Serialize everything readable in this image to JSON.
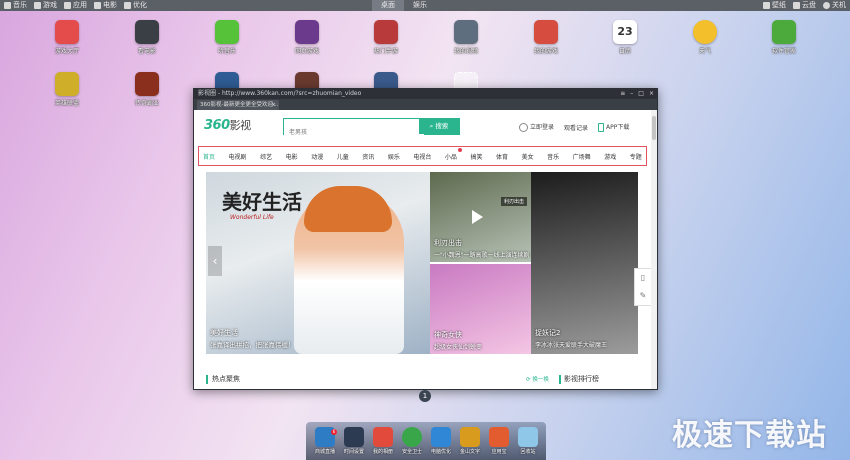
{
  "topbar": {
    "left": [
      {
        "label": "音乐",
        "color": "#d9d9d9"
      },
      {
        "label": "游戏",
        "color": "#d9d9d9"
      },
      {
        "label": "应用",
        "color": "#d9d9d9"
      },
      {
        "label": "电影",
        "color": "#d9d9d9"
      },
      {
        "label": "优化",
        "color": "#d9d9d9"
      }
    ],
    "center": [
      {
        "label": "桌面",
        "active": true
      },
      {
        "label": "娱乐",
        "active": false
      }
    ],
    "right": [
      {
        "label": "壁纸",
        "color": "#d9d9d9"
      },
      {
        "label": "云盘",
        "color": "#d9d9d9"
      },
      {
        "label": "关机",
        "color": "#d9d9d9"
      }
    ]
  },
  "desktop_icons": [
    {
      "label": "游戏大厅",
      "color": "#e44b4b",
      "icon": "joystick-icon"
    },
    {
      "label": "看电影",
      "color": "#3a3f46",
      "icon": "clapperboard-icon"
    },
    {
      "label": "听音乐",
      "color": "#56c23a",
      "icon": "music-note-icon"
    },
    {
      "label": "网页游戏",
      "color": "#6b3a8c",
      "icon": "game-icon"
    },
    {
      "label": "热门手游",
      "color": "#b83a3a",
      "icon": "game-icon"
    },
    {
      "label": "我的视频",
      "color": "#5e6e7e",
      "icon": "video-icon"
    },
    {
      "label": "我的游戏",
      "color": "#d64c3f",
      "icon": "game-icon"
    },
    {
      "label": "日历",
      "color": "#ffffff",
      "icon": "calendar-icon",
      "badge": "23"
    },
    {
      "label": "天气",
      "color": "#f3c02b",
      "icon": "weather-icon"
    },
    {
      "label": "软件管家",
      "color": "#4caa3c",
      "icon": "app-store-icon"
    },
    {
      "label": "英雄联盟",
      "color": "#cfae2a",
      "icon": "star-icon"
    },
    {
      "label": "传奇霸业",
      "color": "#8a2e1e",
      "icon": "game-icon"
    },
    {
      "label": "",
      "color": "#2f5c94",
      "icon": "game-icon"
    },
    {
      "label": "",
      "color": "#6a3a2f",
      "icon": "game-icon"
    },
    {
      "label": "",
      "color": "#3b5a8c",
      "icon": "game-icon"
    },
    {
      "label": "",
      "color": "rgba(255,255,255,0.5)",
      "icon": "add-icon"
    }
  ],
  "browser": {
    "title": "影视圈 - http://www.360kan.com/?src=zhuomian_video",
    "tab": "360影视-最新更全更全受欢迎...",
    "site": {
      "logo_num": "360",
      "logo_text": "影视",
      "search_placeholder": "老男孩",
      "search_button": "搜索",
      "login": "立即登录",
      "history": "观看记录",
      "app": "APP下载",
      "nav": [
        "首页",
        "电视剧",
        "综艺",
        "电影",
        "动漫",
        "儿童",
        "资讯",
        "娱乐",
        "电视台",
        "小品",
        "搞笑",
        "体育",
        "美女",
        "音乐",
        "广场舞",
        "游戏",
        "专题"
      ],
      "hero": {
        "calligraphy": "美好生活",
        "subtitle": "Wonderful Life",
        "title": "美好生活",
        "desc": "张嘉译出拼招，把张嘉伟缓！"
      },
      "tiles": [
        {
          "title": "利刃出击",
          "desc": "一\"小魏恩\"一路高歌一线上演连续剧",
          "badge": "利刃出击",
          "colors": [
            "#5d6a4e",
            "#b7c2b6"
          ]
        },
        {
          "title": "捉妖记2",
          "desc": "李冰冰张天爱联手大破魔王",
          "colors": [
            "#1c1c1c",
            "#9c9c9c"
          ]
        },
        {
          "title": "神奇女侠",
          "desc": "超级女侠仙剑蜕变",
          "colors": [
            "#c97ac2",
            "#f4c6e4"
          ]
        }
      ],
      "sections": {
        "hot": "热点聚焦",
        "more": "换一换",
        "rank": "影视排行榜"
      }
    }
  },
  "pager": {
    "page": "1"
  },
  "dock": [
    {
      "label": "商城直播",
      "color": "#2e7cc4",
      "badge": "6"
    },
    {
      "label": "时间设置",
      "color": "#2c3a52"
    },
    {
      "label": "我的相册",
      "color": "#e24b3b"
    },
    {
      "label": "安全卫士",
      "color": "#3aa64a"
    },
    {
      "label": "电脑优化",
      "color": "#2f87d6"
    },
    {
      "label": "金山文字",
      "color": "#d89b1e"
    },
    {
      "label": "应用宝",
      "color": "#e35c2f"
    },
    {
      "label": "回收站",
      "color": "#8fc7e8"
    }
  ],
  "watermark": "极速下载站"
}
